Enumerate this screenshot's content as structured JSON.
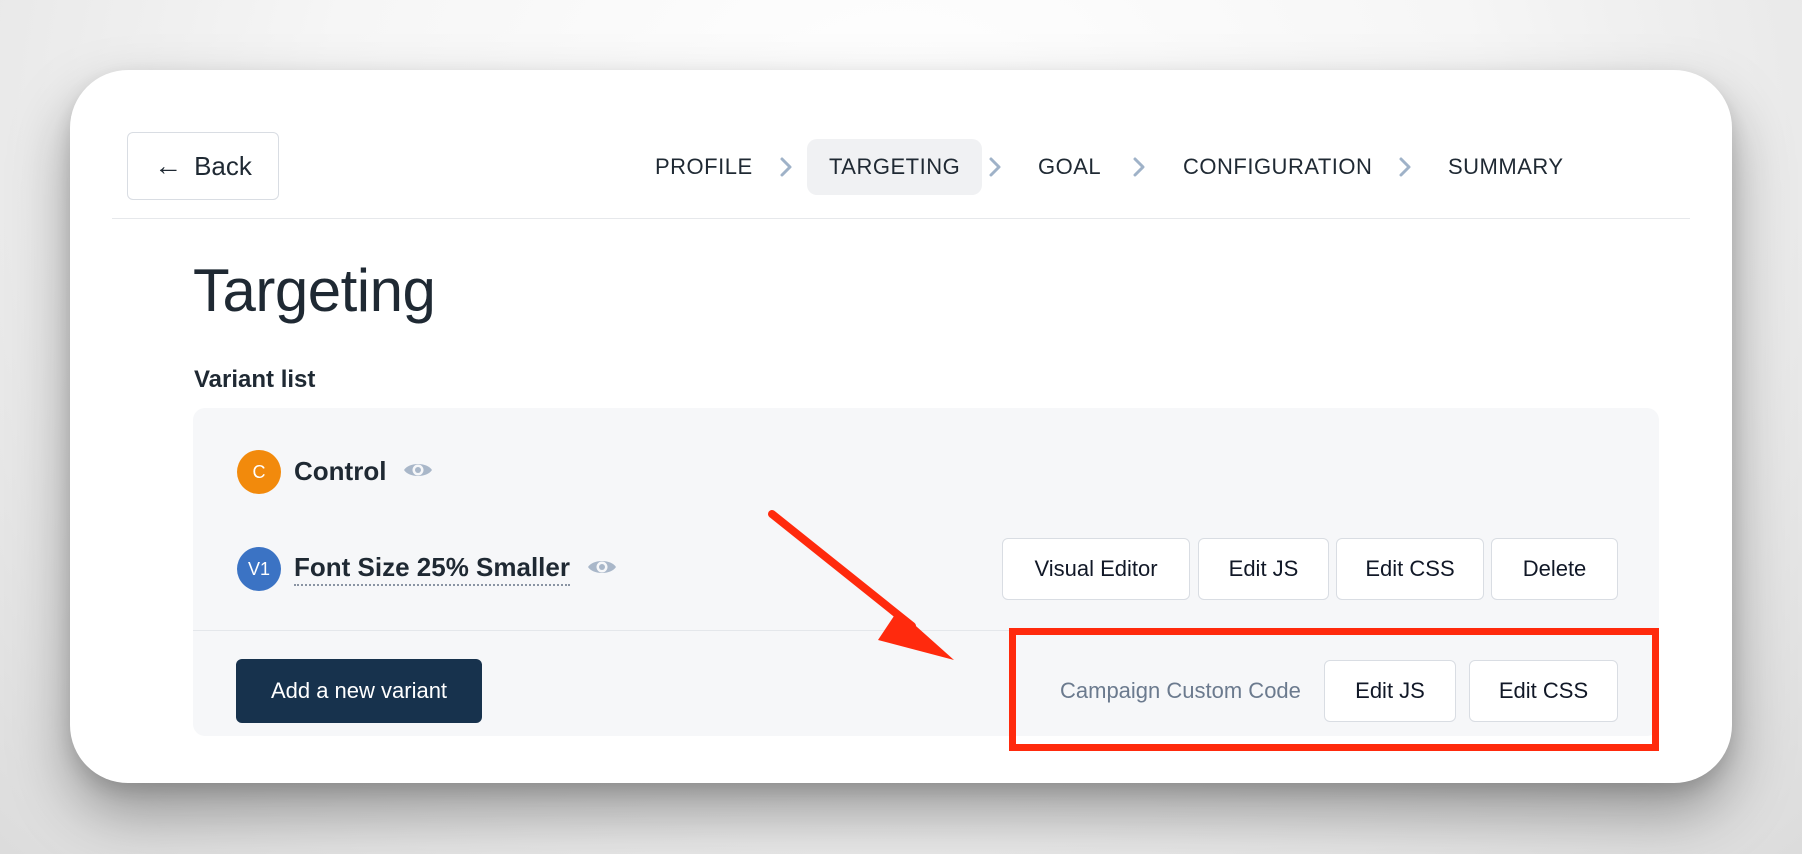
{
  "header": {
    "back_label": "Back",
    "steps": [
      "PROFILE",
      "TARGETING",
      "GOAL",
      "CONFIGURATION",
      "SUMMARY"
    ],
    "active_step": "TARGETING"
  },
  "main": {
    "title": "Targeting",
    "variant_list_label": "Variant list",
    "variants": [
      {
        "badge": "C",
        "badge_color": "#f28a0c",
        "name": "Control"
      },
      {
        "badge": "V1",
        "badge_color": "#3b73c4",
        "name": "Font Size 25% Smaller",
        "actions": [
          "Visual Editor",
          "Edit JS",
          "Edit CSS",
          "Delete"
        ]
      }
    ],
    "add_variant_label": "Add a new variant",
    "campaign_custom_code": {
      "label": "Campaign Custom Code",
      "edit_js": "Edit JS",
      "edit_css": "Edit CSS"
    }
  },
  "colors": {
    "annotation": "#ff2a0d",
    "primary_button": "#17324d",
    "chevron": "#9fb2c8",
    "eye_icon": "#a9b7c9"
  },
  "icons": [
    "left-arrow-icon",
    "chevron-right-icon",
    "eye-icon"
  ]
}
